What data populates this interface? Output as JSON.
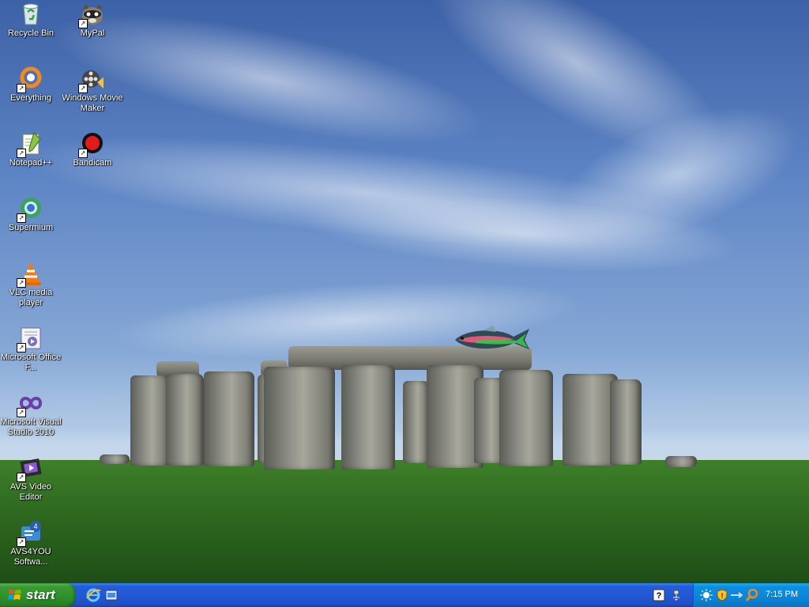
{
  "desktop": {
    "icons": [
      {
        "id": "recycle-bin",
        "label": "Recycle Bin",
        "icon": "recycle-bin-icon"
      },
      {
        "id": "mypal",
        "label": "MyPal",
        "icon": "mypal-icon"
      },
      {
        "id": "everything",
        "label": "Everything",
        "icon": "everything-icon"
      },
      {
        "id": "windows-movie-maker",
        "label": "Windows Movie Maker",
        "icon": "movie-maker-icon"
      },
      {
        "id": "notepadpp",
        "label": "Notepad++",
        "icon": "notepadpp-icon"
      },
      {
        "id": "bandicam",
        "label": "Bandicam",
        "icon": "bandicam-icon"
      },
      {
        "id": "supermium",
        "label": "Supermium",
        "icon": "supermium-icon"
      },
      {
        "id": "vlc",
        "label": "VLC media player",
        "icon": "vlc-icon"
      },
      {
        "id": "office",
        "label": "Microsoft Office F...",
        "icon": "office-icon"
      },
      {
        "id": "visual-studio",
        "label": "Microsoft Visual Studio 2010",
        "icon": "visual-studio-icon"
      },
      {
        "id": "avs-video-editor",
        "label": "AVS Video Editor",
        "icon": "avs-video-editor-icon"
      },
      {
        "id": "avs4you",
        "label": "AVS4YOU Softwa...",
        "icon": "avs4you-icon"
      }
    ]
  },
  "taskbar": {
    "start_label": "start",
    "clock": "7:15 PM",
    "colors": {
      "taskbar": "#245edb",
      "start": "#3a9b34",
      "tray": "#0c85d8"
    }
  }
}
